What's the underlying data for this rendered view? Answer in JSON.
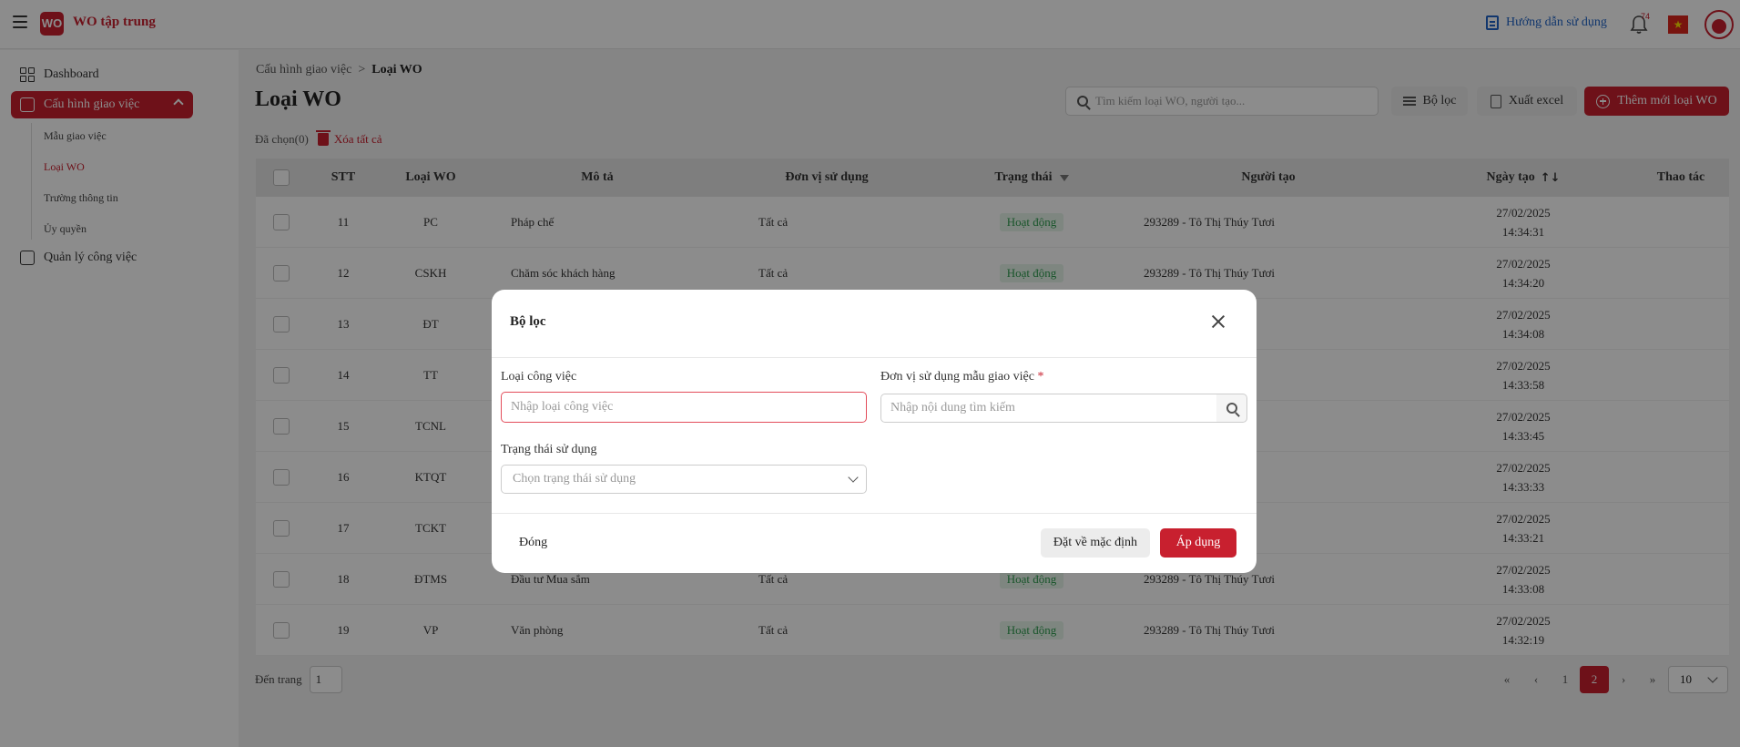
{
  "header": {
    "logo_text": "WO",
    "app_title": "WO tập trung",
    "guide_label": "Hướng dẫn sử dụng",
    "notification_count": "74"
  },
  "sidebar": {
    "items": [
      {
        "label": "Dashboard"
      },
      {
        "label": "Cấu hình giao việc"
      },
      {
        "label": "Quản lý công việc"
      }
    ],
    "sub_items": [
      {
        "label": "Mẫu giao việc"
      },
      {
        "label": "Loại WO"
      },
      {
        "label": "Trường thông tin"
      },
      {
        "label": "Ủy quyền"
      }
    ]
  },
  "breadcrumb": {
    "parent": "Cấu hình giao việc",
    "separator": ">",
    "current": "Loại WO"
  },
  "page": {
    "title": "Loại WO",
    "search_placeholder": "Tìm kiếm loại WO, người tạo...",
    "filter_label": "Bộ lọc",
    "export_label": "Xuất excel",
    "add_label": "Thêm mới loại WO",
    "selected_label": "Đã chọn(0)",
    "clear_all_label": "Xóa tất cả"
  },
  "table": {
    "columns": [
      "STT",
      "Loại WO",
      "Mô tả",
      "Đơn vị sử dụng",
      "Trạng thái",
      "Người tạo",
      "Ngày tạo",
      "Thao tác"
    ],
    "rows": [
      {
        "stt": "11",
        "type": "PC",
        "desc": "Pháp chế",
        "unit": "Tất cả",
        "status": "Hoạt động",
        "creator": "293289 - Tô Thị Thúy Tươi",
        "date": "27/02/2025",
        "time": "14:34:31"
      },
      {
        "stt": "12",
        "type": "CSKH",
        "desc": "Chăm sóc khách hàng",
        "unit": "Tất cả",
        "status": "Hoạt động",
        "creator": "293289 - Tô Thị Thúy Tươi",
        "date": "27/02/2025",
        "time": "14:34:20"
      },
      {
        "stt": "13",
        "type": "ĐT",
        "desc": "",
        "unit": "",
        "status": "",
        "creator": "Tươi",
        "date": "27/02/2025",
        "time": "14:34:08"
      },
      {
        "stt": "14",
        "type": "TT",
        "desc": "",
        "unit": "",
        "status": "",
        "creator": "Tươi",
        "date": "27/02/2025",
        "time": "14:33:58"
      },
      {
        "stt": "15",
        "type": "TCNL",
        "desc": "",
        "unit": "",
        "status": "",
        "creator": "Tươi",
        "date": "27/02/2025",
        "time": "14:33:45"
      },
      {
        "stt": "16",
        "type": "KTQT",
        "desc": "",
        "unit": "",
        "status": "",
        "creator": "Tươi",
        "date": "27/02/2025",
        "time": "14:33:33"
      },
      {
        "stt": "17",
        "type": "TCKT",
        "desc": "",
        "unit": "",
        "status": "",
        "creator": "Tươi",
        "date": "27/02/2025",
        "time": "14:33:21"
      },
      {
        "stt": "18",
        "type": "ĐTMS",
        "desc": "Đầu tư Mua sắm",
        "unit": "Tất cả",
        "status": "Hoạt động",
        "creator": "293289 - Tô Thị Thúy Tươi",
        "date": "27/02/2025",
        "time": "14:33:08"
      },
      {
        "stt": "19",
        "type": "VP",
        "desc": "Văn phòng",
        "unit": "Tất cả",
        "status": "Hoạt động",
        "creator": "293289 - Tô Thị Thúy Tươi",
        "date": "27/02/2025",
        "time": "14:32:19"
      }
    ]
  },
  "pagination": {
    "goto_label": "Đến trang",
    "goto_value": "1",
    "first": "«",
    "prev": "‹",
    "pages": [
      "1",
      "2"
    ],
    "current_page": "2",
    "next": "›",
    "last": "»",
    "page_size": "10"
  },
  "modal": {
    "title": "Bộ lọc",
    "work_type_label": "Loại công việc",
    "work_type_placeholder": "Nhập loại công việc",
    "unit_label": "Đơn vị sử dụng mẫu giao việc",
    "unit_required": "*",
    "unit_placeholder": "Nhập nội dung tìm kiếm",
    "status_label": "Trạng thái sử dụng",
    "status_placeholder": "Chọn trạng thái sử dụng",
    "close_label": "Đóng",
    "reset_label": "Đặt về mặc định",
    "apply_label": "Áp dụng"
  },
  "colors": {
    "brand": "#c8202f",
    "link": "#1f63c7",
    "success": "#2e9b4f"
  }
}
